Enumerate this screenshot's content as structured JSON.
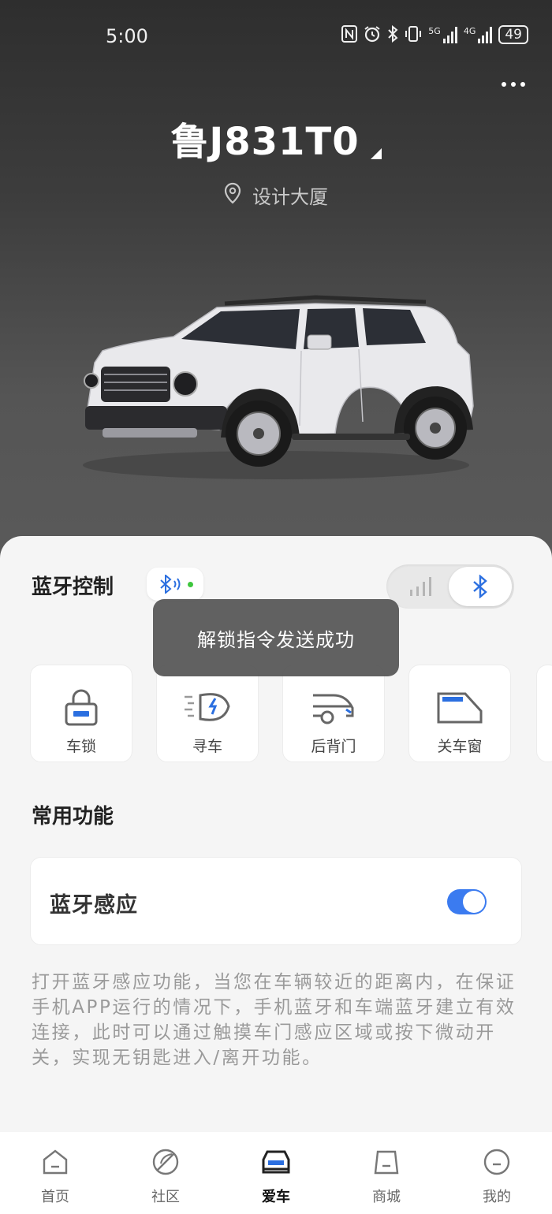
{
  "status_bar": {
    "time": "5:00",
    "battery": "49",
    "sig1_label": "5G",
    "sig2_label": "4G"
  },
  "header": {
    "plate": "鲁J831T0",
    "location": "设计大厦"
  },
  "bluetooth_control": {
    "title": "蓝牙控制"
  },
  "toast": {
    "message": "解锁指令发送成功"
  },
  "controls": [
    {
      "label": "车锁",
      "icon": "lock-icon"
    },
    {
      "label": "寻车",
      "icon": "find-car-icon"
    },
    {
      "label": "后背门",
      "icon": "tailgate-icon"
    },
    {
      "label": "关车窗",
      "icon": "window-icon"
    }
  ],
  "common": {
    "title": "常用功能",
    "bluetooth_sense_label": "蓝牙感应",
    "bluetooth_sense_on": true,
    "description": "打开蓝牙感应功能，当您在车辆较近的距离内，在保证手机APP运行的情况下，手机蓝牙和车端蓝牙建立有效连接，此时可以通过触摸车门感应区域或按下微动开关，实现无钥匙进入/离开功能。"
  },
  "tabs": [
    {
      "label": "首页",
      "icon": "home-icon",
      "active": false
    },
    {
      "label": "社区",
      "icon": "community-icon",
      "active": false
    },
    {
      "label": "爱车",
      "icon": "car-icon",
      "active": true
    },
    {
      "label": "商城",
      "icon": "mall-icon",
      "active": false
    },
    {
      "label": "我的",
      "icon": "profile-icon",
      "active": false
    }
  ],
  "colors": {
    "accent": "#3b7bf0",
    "bluetooth": "#2b6fe0",
    "online_dot": "#3ec63e"
  }
}
